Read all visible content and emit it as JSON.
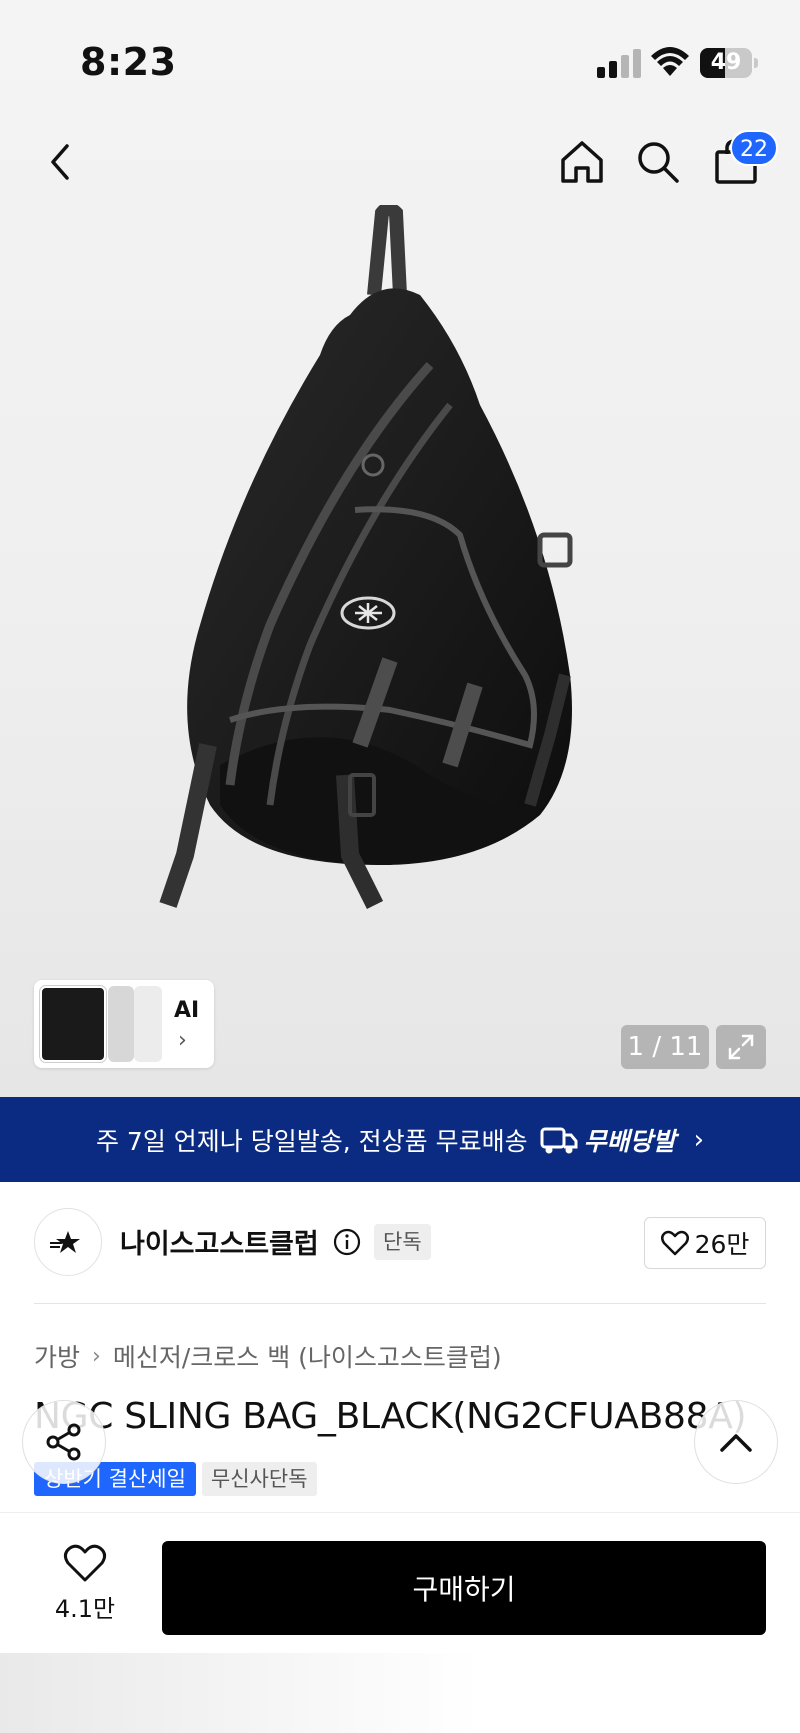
{
  "status_bar": {
    "time": "8:23",
    "battery": "49",
    "battery_level": 0.49
  },
  "nav": {
    "cart_count": "22"
  },
  "gallery": {
    "counter": "1 / 11",
    "ai_label": "AI"
  },
  "banner": {
    "text": "주 7일 언제나 당일발송, 전상품 무료배송",
    "logo_text": "무배당발"
  },
  "brand": {
    "name": "나이스고스트클럽",
    "tag": "단독",
    "likes": "26만"
  },
  "breadcrumb": [
    "가방",
    "메신저/크로스 백 (나이스고스트클럽)"
  ],
  "product": {
    "title": "NGC SLING BAG_BLACK(NG2CFUAB88A)",
    "tags": [
      "상반기 결산세일",
      "무신사단독"
    ]
  },
  "bottom_bar": {
    "wish_count": "4.1만",
    "buy_label": "구매하기"
  },
  "colors": {
    "accent_blue": "#1f66ff",
    "banner_navy": "#0b2b82",
    "button_black": "#000000"
  }
}
